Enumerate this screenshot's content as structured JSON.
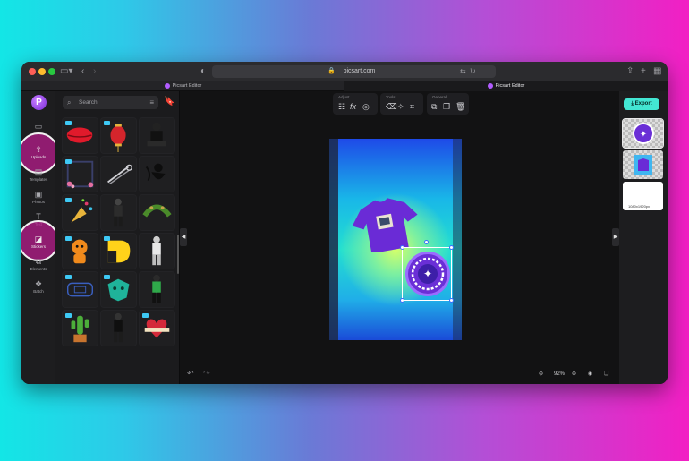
{
  "browser": {
    "url": "picsart.com",
    "tabs": [
      {
        "label": "Picsart Editor",
        "active": false
      },
      {
        "label": "Picsart Editor",
        "active": true
      }
    ]
  },
  "rail": {
    "logo": "P",
    "items": [
      {
        "label": "",
        "icon": "layout-icon"
      },
      {
        "label": "Uploads",
        "icon": "upload-icon"
      },
      {
        "label": "Templates",
        "icon": "templates-icon"
      },
      {
        "label": "Photos",
        "icon": "photos-icon"
      },
      {
        "label": "Text",
        "icon": "text-icon"
      },
      {
        "label": "Stickers",
        "icon": "stickers-icon"
      },
      {
        "label": "Elements",
        "icon": "elements-icon"
      },
      {
        "label": "Batch",
        "icon": "batch-icon"
      }
    ]
  },
  "panel": {
    "search_placeholder": "Search"
  },
  "toolbar": {
    "groups": [
      {
        "title": "Adjust"
      },
      {
        "title": "Tools"
      },
      {
        "title": "General"
      }
    ]
  },
  "zoom": {
    "level": "92%"
  },
  "right": {
    "export_label": "Export",
    "size_label": "1080x1920px"
  },
  "colors": {
    "accent": "#43e6d3",
    "brand": "#8a3bf0",
    "highlight": "#b71c8c"
  }
}
